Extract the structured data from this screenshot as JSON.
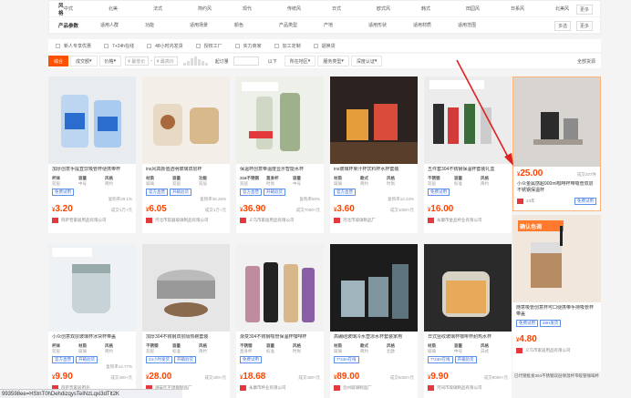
{
  "attributes": {
    "rows": [
      {
        "key": "风格",
        "values": [
          "中式",
          "北美",
          "法式",
          "简约风",
          "现代",
          "传统风",
          "日式",
          "欧式风",
          "韩式",
          "田园风",
          "日系风",
          "北美风"
        ]
      },
      {
        "key": "产品参数",
        "values": [
          "适用人群",
          "功能",
          "适用场景",
          "颜色",
          "产品类型",
          "产地",
          "适用形状",
          "适用材质",
          "适用范围"
        ]
      }
    ],
    "more_label": "更多",
    "multi_label": "多选"
  },
  "filters": [
    "新人专享优惠",
    "7+24h在线",
    "48小时内发货",
    "授权工厂",
    "实力商家",
    "加工定制",
    "退换货"
  ],
  "sort": {
    "items": [
      "综合",
      "成交额",
      "价格",
      "¥ 最低价",
      "¥ 最高价"
    ],
    "price_min_placeholder": "¥ 最低价",
    "price_max_placeholder": "¥ 最高价",
    "count_label": "起订量",
    "count_value": "以下",
    "location": "所在地区",
    "service": "服务类型",
    "trust": "深度认证",
    "all": "全部货源"
  },
  "products": [
    {
      "title": "加厚创意手提直饮吸管杯便携带杯",
      "attrs": [
        [
          "杯体",
          "双层"
        ],
        [
          "容量",
          "中号"
        ],
        [
          "风格",
          "简约"
        ]
      ],
      "tags": [
        "免费试用"
      ],
      "rate": "复购率29.1%",
      "price": "3.20",
      "sold": "成交1万+元",
      "shop": "阿萨普家居用品有限公司"
    },
    {
      "title": "ins风高颜值透明玻璃双层杯",
      "attrs": [
        [
          "材质",
          "玻璃"
        ],
        [
          "容量",
          "双层"
        ],
        [
          "功能",
          "双层"
        ]
      ],
      "tags": [
        "官方直营",
        "开箱验货"
      ],
      "rate": "复购率36.26%",
      "price": "6.05",
      "sold": "成交1万+元",
      "shop": "河北市容器玻璃制品有限公司"
    },
    {
      "title": "保温杯创意带温度显示智能水杯",
      "attrs": [
        [
          "316不锈钢",
          "双层"
        ],
        [
          "直身杯",
          "时尚"
        ],
        [
          "容量",
          "中号"
        ]
      ],
      "tags": [
        "官方直营",
        "开箱验货"
      ],
      "rate": "复购率80%",
      "price": "36.90",
      "sold": "成交7000+元",
      "shop": "义乌市家居用品有限公司"
    },
    {
      "title": "ins玻璃杯果汁杯饮料杯水杯套装",
      "attrs": [
        [
          "材质",
          "玻璃"
        ],
        [
          "款式",
          "简约"
        ],
        [
          "风格",
          "时尚"
        ]
      ],
      "tags": [
        "官方直营"
      ],
      "rate": "复购率12.23%",
      "price": "3.60",
      "sold": "成交1000+元",
      "shop": "河北市玻璃制品厂"
    },
    {
      "title": "五件套304不锈钢保温杯套装礼盒",
      "attrs": [
        [
          "不锈钢",
          "双层"
        ],
        [
          "容量",
          "标准"
        ],
        [
          "风格",
          "简约"
        ]
      ],
      "tags": [
        "免费试用"
      ],
      "rate": "",
      "price": "16.00",
      "sold": "",
      "shop": "永康市金品杯业有限公司"
    },
    {
      "title": "小众创意双层玻璃杯冰块杯带盖",
      "attrs": [
        [
          "杯体",
          "双层"
        ],
        [
          "材质",
          "玻璃"
        ],
        [
          "风格",
          "简约"
        ]
      ],
      "tags": [
        "官方直营",
        "开箱验货"
      ],
      "rate": "复购率14.77%",
      "price": "9.90",
      "sold": "成交400+元",
      "shop": "阿萨普家居用品"
    },
    {
      "title": "加厚304不锈钢双层隔热碗套装",
      "attrs": [
        [
          "不锈钢",
          "双层"
        ],
        [
          "容量",
          "标准"
        ],
        [
          "风格",
          "简约"
        ]
      ],
      "tags": [
        "24小时发货",
        "开箱验货"
      ],
      "rate": "",
      "price": "28.00",
      "sold": "成交400+元",
      "shop": "潮安区不锈钢制品厂"
    },
    {
      "title": "渐变304不锈钢吸管保温杯咖啡杯",
      "attrs": [
        [
          "不锈钢",
          "直身杯"
        ],
        [
          "容量",
          "标准"
        ],
        [
          "风格",
          "时尚"
        ]
      ],
      "tags": [
        "免费试用"
      ],
      "rate": "",
      "price": "18.68",
      "sold": "成交400+元",
      "shop": "永康市杯业有限公司"
    },
    {
      "title": "高硼硅玻璃冷水壶凉水杯套装家用",
      "attrs": [
        [
          "材质",
          "玻璃"
        ],
        [
          "款式",
          "简约"
        ],
        [
          "风格",
          "北欧"
        ]
      ],
      "tags": [
        "7*24H在线"
      ],
      "rate": "",
      "price": "89.00",
      "sold": "成交5000+元",
      "shop": "沧州玻璃制品厂"
    },
    {
      "title": "日式竖纹玻璃杯咖啡杯耐热水杯",
      "attrs": [
        [
          "材质",
          "玻璃"
        ],
        [
          "容量",
          "中号"
        ],
        [
          "风格",
          "日式"
        ]
      ],
      "tags": [
        "7*24H在线",
        "开箱验货"
      ],
      "rate": "",
      "price": "9.90",
      "sold": "成交8000+元",
      "shop": "河间市玻璃制品有限公司"
    }
  ],
  "side": {
    "top": {
      "price": "25.00",
      "sold": "成交207件",
      "title": "小众金属感超900ml咖啡杯带吸管双层不锈钢保温杯",
      "count": "23年",
      "tags": [
        "免费试用"
      ]
    },
    "bottom": {
      "badge": "确认色调",
      "price": "4.80",
      "title": "随意吸管创意杯可口便携带手持吸管杯带盖",
      "tags": [
        "免费试用",
        "48H发货"
      ],
      "shop": "义乌市家居用品有限公司"
    },
    "more_item": "已代销批发304不锈钢双层保温杯带吸管咖啡杯"
  },
  "url": "993598ee=HStnT0hDehdizqysTeINzLqxi3dTlt2K"
}
